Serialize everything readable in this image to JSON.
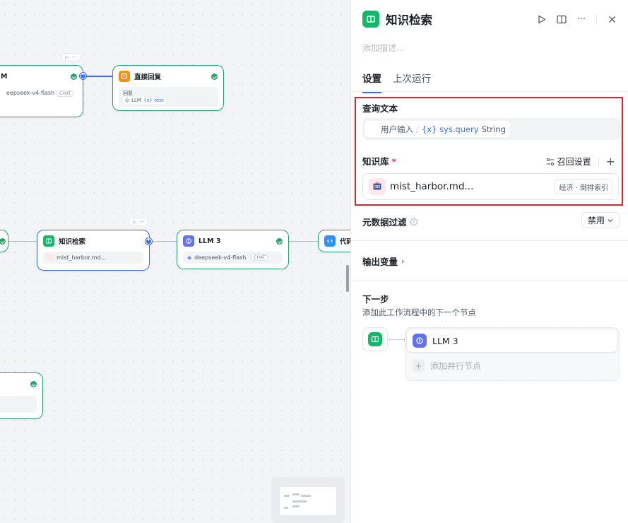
{
  "canvas": {
    "nodes": {
      "llm_top": {
        "title": "M",
        "model": "eepseek-v4-flash",
        "chip": "CHAT"
      },
      "direct_reply": {
        "title": "直接回复",
        "body_label": "回复",
        "ref_source": "LLM",
        "ref_var": "{x} text"
      },
      "kb_search": {
        "title": "知识检索",
        "file": "mist_harbor.md..."
      },
      "llm3": {
        "title": "LLM 3",
        "model": "deepseek-v4-flash",
        "chip": "CHAT"
      },
      "code": {
        "title": "代码"
      }
    }
  },
  "panel": {
    "title": "知识检索",
    "description_placeholder": "添加描述...",
    "tabs": [
      {
        "label": "设置",
        "active": true
      },
      {
        "label": "上次运行",
        "active": false
      }
    ],
    "query": {
      "label": "查询文本",
      "source": "用户输入",
      "separator": "/",
      "variable": "{x} sys.query",
      "type": "String"
    },
    "knowledge_base": {
      "label": "知识库",
      "required_mark": "*",
      "recall_settings": "召回设置",
      "add": "+",
      "item_name": "mist_harbor.md...",
      "item_tag": "经济 · 倒排索引"
    },
    "metadata_filter": {
      "label": "元数据过滤",
      "value": "禁用"
    },
    "output_vars": {
      "label": "输出变量"
    },
    "next_step": {
      "title": "下一步",
      "description": "添加此工作流程中的下一个节点",
      "next_node": "LLM 3",
      "add_parallel": "添加并行节点"
    }
  },
  "colors": {
    "accent": "#3b6cf6",
    "success": "#29a36a",
    "kb_icon": "#12b76a",
    "llm_icon": "#6172f3",
    "reply_icon": "#f79009",
    "highlight": "#d9262c"
  }
}
